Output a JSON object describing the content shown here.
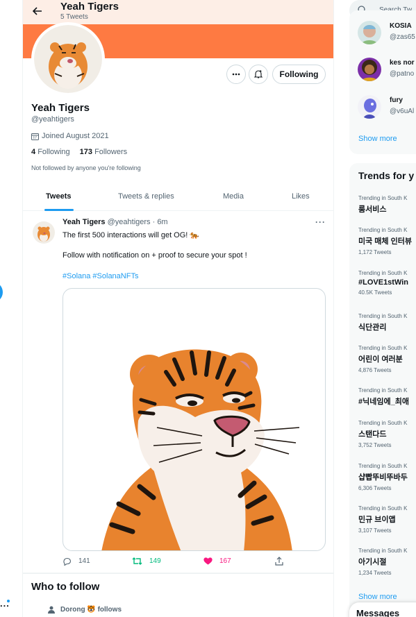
{
  "header": {
    "title": "Yeah Tigers",
    "subtitle": "5 Tweets"
  },
  "profile": {
    "name": "Yeah Tigers",
    "handle": "@yeahtigers",
    "joined": "Joined August 2021",
    "following_count": "4",
    "following_label": "Following",
    "followers_count": "173",
    "followers_label": "Followers",
    "not_followed": "Not followed by anyone you're following",
    "follow_button": "Following",
    "colors": {
      "banner": "#fe7a42",
      "topbar": "#fdeee6",
      "accent": "#1d9bf0"
    }
  },
  "tabs": [
    {
      "label": "Tweets"
    },
    {
      "label": "Tweets & replies"
    },
    {
      "label": "Media"
    },
    {
      "label": "Likes"
    }
  ],
  "tweet": {
    "name": "Yeah Tigers",
    "handle_time": "@yeahtigers · 6m",
    "text": "The first 500 interactions will get OG! 🐅",
    "text2": "Follow with notification on + proof to secure your spot !",
    "tags": "#Solana #SolanaNFTs",
    "replies": "141",
    "retweets": "149",
    "likes": "167",
    "more": "···"
  },
  "who_to_follow": {
    "title": "Who to follow",
    "row_name": "Dorong",
    "row_follows": "follows"
  },
  "sidebar": {
    "search_placeholder": "Search Tw",
    "who": [
      {
        "name": "KOSIA",
        "handle": "@zas65"
      },
      {
        "name": "kes nor",
        "handle": "@patno"
      },
      {
        "name": "fury",
        "handle": "@v6uAl"
      }
    ],
    "show_more": "Show more",
    "trends_title": "Trends for y",
    "trends": [
      {
        "context": "Trending in South K",
        "name": "룸서비스",
        "count": ""
      },
      {
        "context": "Trending in South K",
        "name": "미국 매체 인터뷰",
        "count": "1,172 Tweets"
      },
      {
        "context": "Trending in South K",
        "name": "#LOVE1stWin",
        "count": "40.5K Tweets"
      },
      {
        "context": "Trending in South K",
        "name": "식단관리",
        "count": ""
      },
      {
        "context": "Trending in South K",
        "name": "어린이 여러분",
        "count": "4,876 Tweets"
      },
      {
        "context": "Trending in South K",
        "name": "#닉네임에_최애",
        "count": ""
      },
      {
        "context": "Trending in South K",
        "name": "스탠다드",
        "count": "3,752 Tweets"
      },
      {
        "context": "Trending in South K",
        "name": "샵빱뚜비뚜바두",
        "count": "6,306 Tweets"
      },
      {
        "context": "Trending in South K",
        "name": "민규 브이앱",
        "count": "3,107 Tweets"
      },
      {
        "context": "Trending in South K",
        "name": "아기시절",
        "count": "1,234 Tweets"
      }
    ],
    "trends_show_more": "Show more",
    "messages": "Messages"
  },
  "left": {
    "more": "..."
  }
}
